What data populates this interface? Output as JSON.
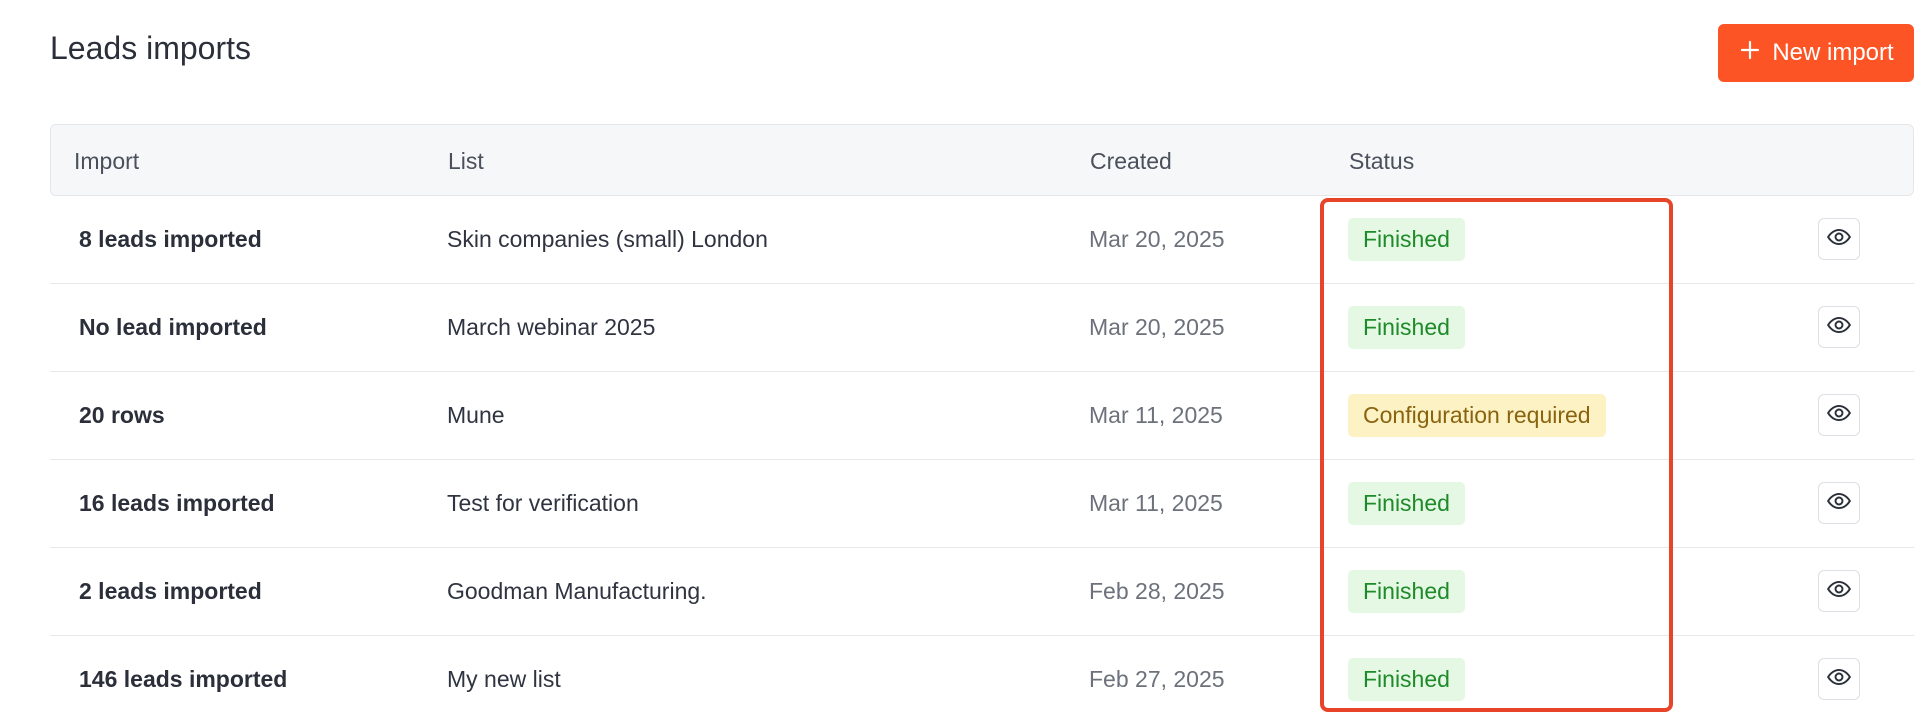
{
  "page": {
    "title": "Leads imports"
  },
  "toolbar": {
    "new_import_label": "New import",
    "new_import_icon": "plus-icon",
    "accent": "#fc5425"
  },
  "table": {
    "columns": [
      "Import",
      "List",
      "Created",
      "Status"
    ],
    "rows": [
      {
        "import": "8 leads imported",
        "list": "Skin companies (small) London",
        "created": "Mar 20, 2025",
        "status": "Finished"
      },
      {
        "import": "No lead imported",
        "list": "March webinar 2025",
        "created": "Mar 20, 2025",
        "status": "Finished"
      },
      {
        "import": "20 rows",
        "list": "Mune",
        "created": "Mar 11, 2025",
        "status": "Configuration required"
      },
      {
        "import": "16 leads imported",
        "list": "Test for verification",
        "created": "Mar 11, 2025",
        "status": "Finished"
      },
      {
        "import": "2 leads imported",
        "list": "Goodman Manufacturing.",
        "created": "Feb 28, 2025",
        "status": "Finished"
      },
      {
        "import": "146 leads imported",
        "list": "My new list",
        "created": "Feb 27, 2025",
        "status": "Finished"
      }
    ],
    "row_action_icon": "eye-icon"
  },
  "colors": {
    "finished_bg": "#e4f8e4",
    "finished_text": "#1e8a2a",
    "config_bg": "#fdf2c3",
    "config_text": "#8a6310",
    "highlight": "#e8442a"
  }
}
